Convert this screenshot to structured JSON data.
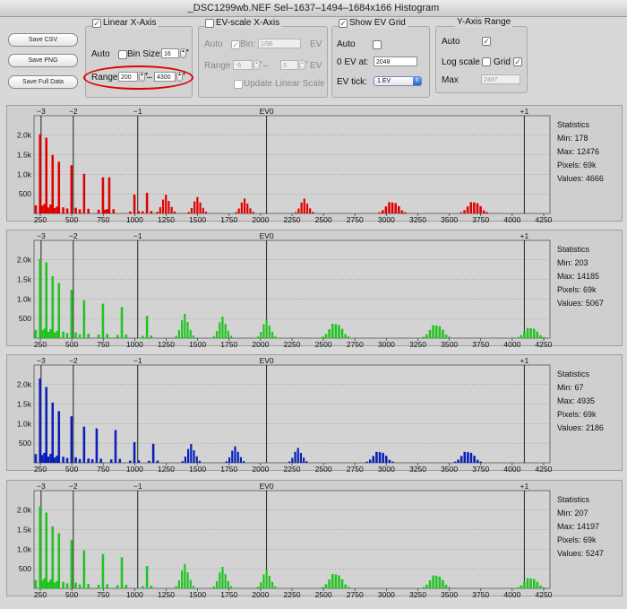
{
  "window": {
    "title": "_DSC1299wb.NEF Sel–1637–1494–1684x166 Histogram"
  },
  "buttons": {
    "save_csv": "Save CSV",
    "save_png": "Save PNG",
    "save_full": "Save Full Data"
  },
  "linear": {
    "title": "Linear X-Axis",
    "checked": true,
    "auto_label": "Auto",
    "bin_label": "Bin Size:",
    "bin_value": "16",
    "range_label": "Range:",
    "range_min": "200",
    "range_dash": "–",
    "range_max": "4300"
  },
  "ev": {
    "title": "EV-scale X-Axis",
    "checked": false,
    "auto_label": "Auto",
    "bin_label": "Bin:",
    "bin_value": "1/96",
    "ev_suffix": "EV",
    "range_label": "Range",
    "range_min": "-5",
    "range_dash": "–",
    "range_max": "3",
    "range_suffix": "EV",
    "update_label": "Update Linear Scale"
  },
  "evgrid": {
    "title": "Show EV Grid",
    "checked": true,
    "auto_label": "Auto",
    "zero_label": "0 EV at:",
    "zero_value": "2048",
    "tick_label": "EV tick:",
    "tick_value": "1 EV"
  },
  "yaxis": {
    "title": "Y-Axis Range",
    "auto_label": "Auto",
    "auto_checked": true,
    "log_label": "Log scale",
    "log_checked": false,
    "grid_label": "Grid",
    "grid_checked": true,
    "max_label": "Max",
    "max_value": "2497"
  },
  "axes": {
    "xticks": [
      "250",
      "500",
      "750",
      "1000",
      "1250",
      "1500",
      "1750",
      "2000",
      "2250",
      "2500",
      "2750",
      "3000",
      "3250",
      "3500",
      "3750",
      "4000",
      "4250"
    ],
    "yticks": [
      "500",
      "1.0k",
      "1.5k",
      "2.0k"
    ],
    "ev_labels": [
      "−3",
      "−2",
      "−1",
      "EV0",
      "+1"
    ]
  },
  "stats_title": "Statistics",
  "panels": [
    {
      "color": "#e00000",
      "min": "Min: 178",
      "max": "Max: 12476",
      "pixels": "Pixels: 69k",
      "values": "Values: 4666"
    },
    {
      "color": "#1fc41f",
      "min": "Min: 203",
      "max": "Max: 14185",
      "pixels": "Pixels: 69k",
      "values": "Values: 5067"
    },
    {
      "color": "#0a1fb8",
      "min": "Min: 67",
      "max": "Max: 4935",
      "pixels": "Pixels: 69k",
      "values": "Values: 2186"
    },
    {
      "color": "#1fc41f",
      "min": "Min: 207",
      "max": "Max: 14197",
      "pixels": "Pixels: 69k",
      "values": "Values: 5247"
    }
  ],
  "chart_data": [
    {
      "type": "bar",
      "series": [
        {
          "values_x": [
            250,
            300,
            350,
            400,
            500,
            600,
            750,
            800,
            1000,
            1100,
            1250,
            1500,
            1875,
            2350,
            3050,
            3700
          ],
          "values": [
            2300,
            2200,
            1700,
            1500,
            1400,
            1150,
            1050,
            1050,
            550,
            600,
            480,
            420,
            380,
            380,
            330,
            330
          ]
        }
      ],
      "xlim": [
        200,
        4300
      ],
      "ylim": [
        0,
        2497
      ],
      "grid": true
    },
    {
      "type": "bar",
      "series": [
        {
          "values_x": [
            250,
            300,
            350,
            400,
            500,
            600,
            750,
            900,
            1100,
            1400,
            1700,
            2050,
            2600,
            3400,
            4150
          ],
          "values": [
            2300,
            2200,
            1800,
            1600,
            1400,
            1100,
            1000,
            900,
            650,
            620,
            550,
            480,
            420,
            380,
            300
          ],
          "name": ""
        }
      ],
      "xlim": [
        200,
        4300
      ],
      "ylim": [
        0,
        2497
      ],
      "grid": true
    },
    {
      "type": "bar",
      "series": [
        {
          "values_x": [
            250,
            300,
            350,
            400,
            500,
            600,
            700,
            850,
            1000,
            1150,
            1450,
            1800,
            2300,
            2950,
            3650
          ],
          "values": [
            2450,
            2200,
            1750,
            1500,
            1350,
            1050,
            1000,
            950,
            600,
            550,
            480,
            420,
            380,
            320,
            320
          ]
        }
      ],
      "xlim": [
        200,
        4300
      ],
      "ylim": [
        0,
        2497
      ],
      "grid": true
    },
    {
      "type": "bar",
      "series": [
        {
          "values_x": [
            250,
            300,
            350,
            400,
            500,
            600,
            750,
            900,
            1100,
            1400,
            1700,
            2050,
            2600,
            3400,
            4150
          ],
          "values": [
            2380,
            2200,
            1800,
            1600,
            1400,
            1100,
            1000,
            900,
            650,
            620,
            550,
            480,
            420,
            380,
            300
          ]
        }
      ],
      "xlim": [
        200,
        4300
      ],
      "ylim": [
        0,
        2497
      ],
      "grid": true
    }
  ]
}
